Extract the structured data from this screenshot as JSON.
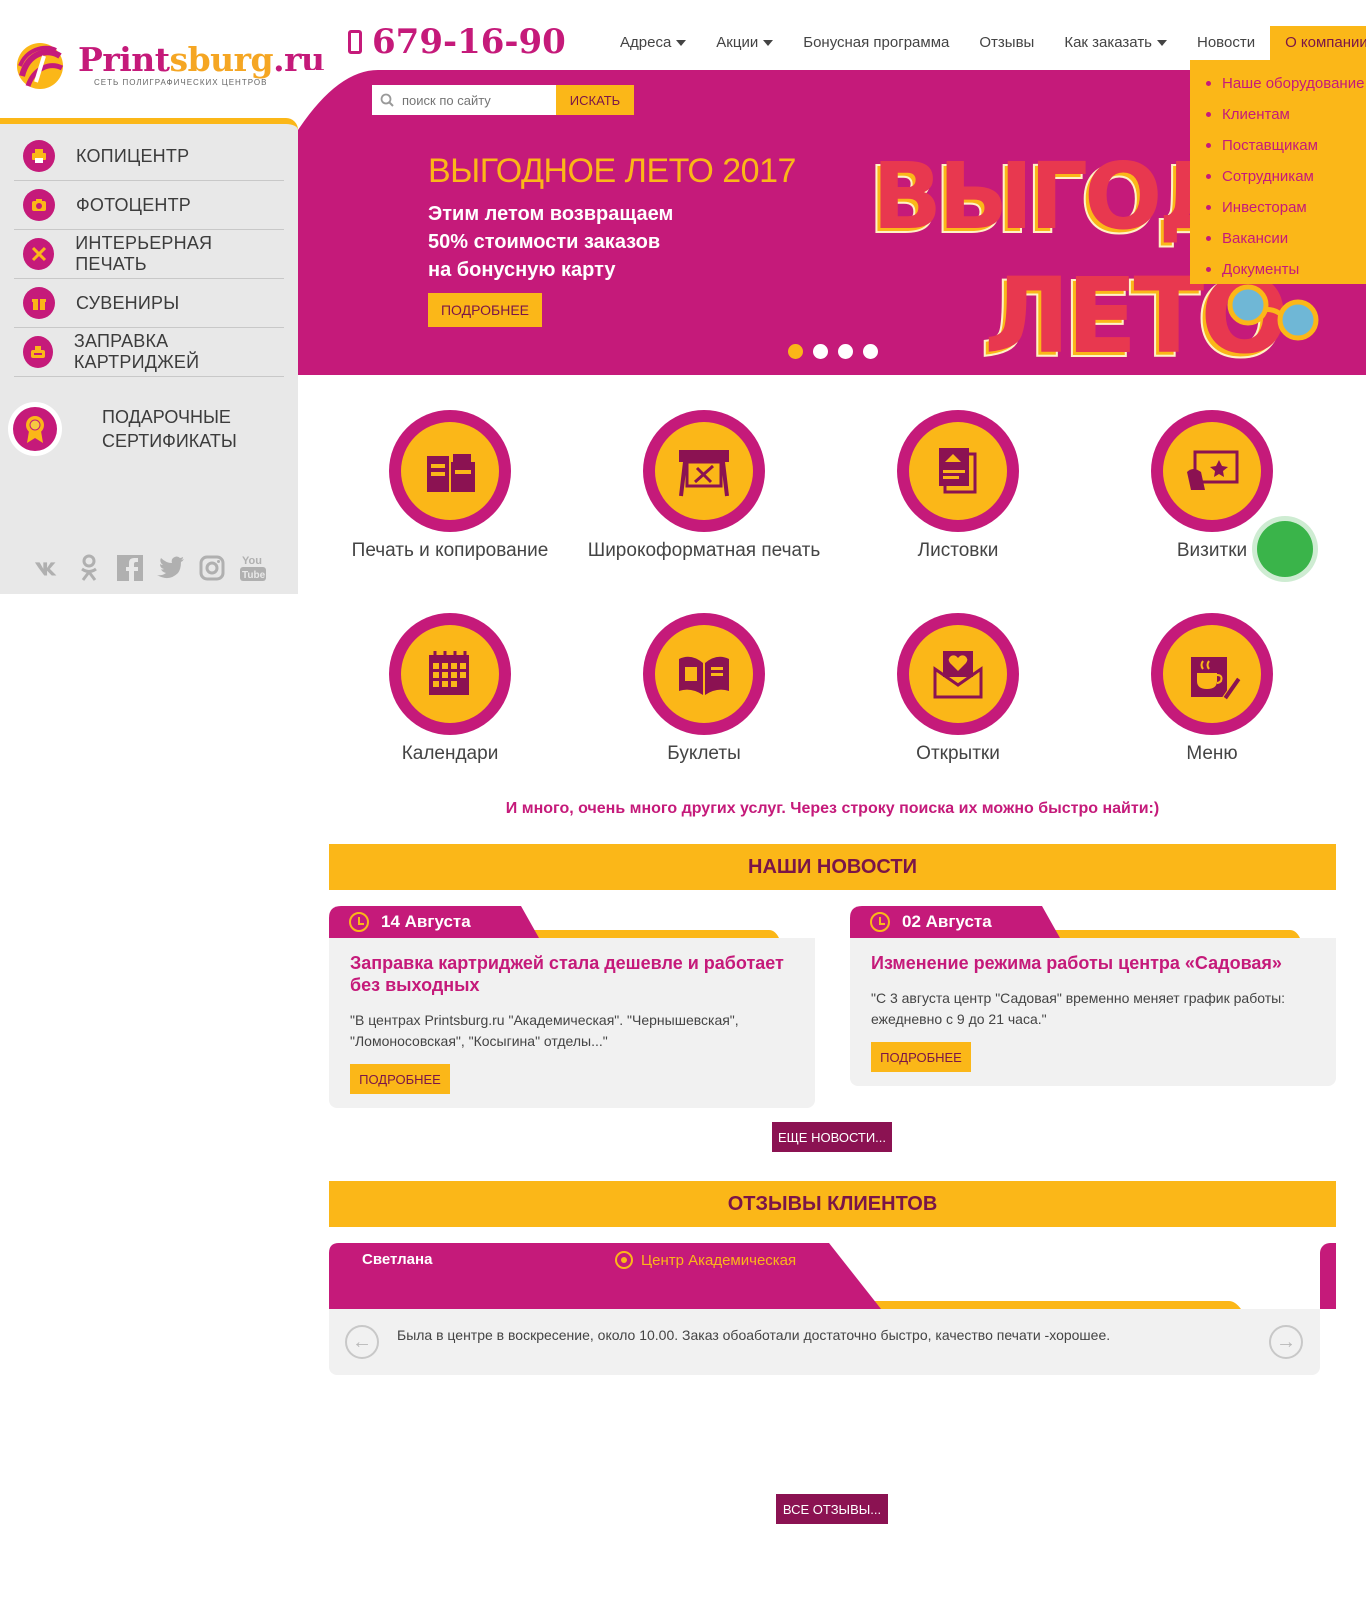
{
  "brand": {
    "name_part1": "Print",
    "name_part2": "sburg",
    "name_part3": ".ru",
    "tagline": "СЕТЬ ПОЛИГРАФИЧЕСКИХ ЦЕНТРОВ"
  },
  "phone": "679-16-90",
  "top_nav": [
    {
      "label": "Адреса",
      "caret": true
    },
    {
      "label": "Акции",
      "caret": true
    },
    {
      "label": "Бонусная программа",
      "caret": false
    },
    {
      "label": "Отзывы",
      "caret": false
    },
    {
      "label": "Как заказать",
      "caret": true
    },
    {
      "label": "Новости",
      "caret": false
    },
    {
      "label": "О компании",
      "caret": true,
      "active": true
    }
  ],
  "company_dropdown": [
    "Наше оборудование",
    "Клиентам",
    "Поставщикам",
    "Сотрудникам",
    "Инвесторам",
    "Вакансии",
    "Документы"
  ],
  "search": {
    "placeholder": "поиск по сайту",
    "button": "ИСКАТЬ"
  },
  "sidebar": {
    "items": [
      {
        "label": "КОПИЦЕНТР",
        "icon": "printer-icon"
      },
      {
        "label": "ФОТОЦЕНТР",
        "icon": "camera-icon"
      },
      {
        "label": "ИНТЕРЬЕРНАЯ ПЕЧАТЬ",
        "icon": "brush-icon"
      },
      {
        "label": "СУВЕНИРЫ",
        "icon": "gift-box-icon"
      },
      {
        "label": "ЗАПРАВКА КАРТРИДЖЕЙ",
        "icon": "cartridge-icon"
      }
    ],
    "gift": {
      "label": "ПОДАРОЧНЫЕ СЕРТИФИКАТЫ",
      "icon": "award-icon"
    },
    "socials": [
      "vk-icon",
      "odnoklassniki-icon",
      "facebook-icon",
      "twitter-icon",
      "instagram-icon",
      "youtube-icon"
    ]
  },
  "banner": {
    "title": "ВЫГОДНОЕ ЛЕТО 2017",
    "text": "Этим летом возвращаем 50% стоимости заказов на бонусную карту",
    "button": "ПОДРОБНЕЕ",
    "art_line1": "ВЫГОДН",
    "art_line2": "ЛЕТО",
    "slides": 4,
    "active_slide": 1
  },
  "services": [
    {
      "label": "Печать и копирование",
      "icon": "copier-icon"
    },
    {
      "label": "Широкоформатная печать",
      "icon": "plotter-icon"
    },
    {
      "label": "Листовки",
      "icon": "flyers-icon"
    },
    {
      "label": "Визитки",
      "icon": "business-card-icon"
    },
    {
      "label": "Календари",
      "icon": "calendar-icon"
    },
    {
      "label": "Буклеты",
      "icon": "booklet-icon"
    },
    {
      "label": "Открытки",
      "icon": "envelope-heart-icon"
    },
    {
      "label": "Меню",
      "icon": "menu-cup-icon"
    }
  ],
  "more_services": "И много, очень много других услуг. Через строку поиска их можно быстро найти:)",
  "news": {
    "heading": "НАШИ НОВОСТИ",
    "items": [
      {
        "date": "14 Августа",
        "title": "Заправка картриджей стала дешевле и работает без выходных",
        "excerpt": "\"В центрах Printsburg.ru  \"Академическая\". \"Чернышевская\", \"Ломоносовская\", \"Косыгина\" отделы...\"",
        "button": "ПОДРОБНЕЕ"
      },
      {
        "date": "02 Августа",
        "title": "Изменение режима работы центра «Садовая»",
        "excerpt": "\"С 3 августа центр \"Садовая\" временно меняет график работы: ежедневно с 9 до 21 часа.\"",
        "button": "ПОДРОБНЕЕ"
      }
    ],
    "more_button": "ЕЩЕ НОВОСТИ..."
  },
  "reviews": {
    "heading": "ОТЗЫВЫ КЛИЕНТОВ",
    "item": {
      "name": "Светлана",
      "center": "Центр Академическая",
      "text": "Была в центре в воскресение, около 10.00. Заказ обоаботали достаточно быстро, качество печати -хорошее."
    },
    "all_button": "ВСЕ ОТЗЫВЫ..."
  },
  "colors": {
    "magenta": "#c51a7a",
    "yellow": "#fbb718",
    "dark_magenta": "#8b1252",
    "sidebar_gray": "#e8e8e8"
  }
}
